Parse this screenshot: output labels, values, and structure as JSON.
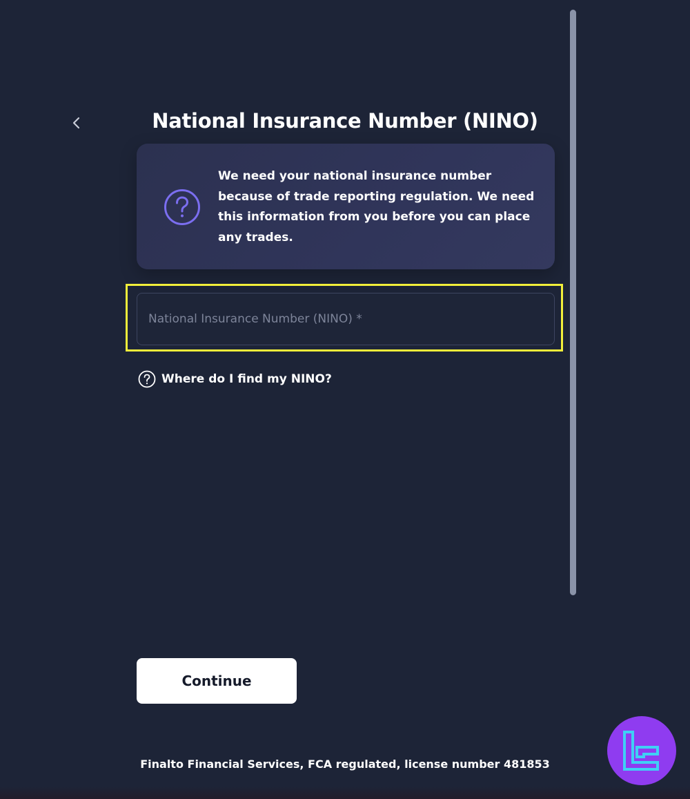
{
  "header": {
    "title": "National Insurance Number (NINO)",
    "back_icon": "chevron-left-icon"
  },
  "info_card": {
    "icon": "question-circle-icon",
    "text": "We need your national insurance number because of trade reporting regulation. We need this information from you before you can place any trades."
  },
  "form": {
    "nino_value": "",
    "nino_placeholder": "National Insurance Number (NINO) *",
    "help_icon": "question-circle-icon",
    "help_link": "Where do I find my NINO?",
    "continue_label": "Continue"
  },
  "footer": {
    "text": "Finalto Financial Services, FCA regulated, license number 481853"
  },
  "colors": {
    "background": "#1d2437",
    "card": "#30355a",
    "accent_icon": "#7b6ef0",
    "highlight": "#f2ef3a",
    "badge": "#8f3cf0",
    "badge_glyph": "#3fd0f5"
  }
}
